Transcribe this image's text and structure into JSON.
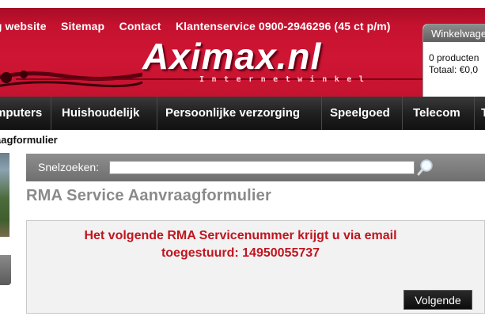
{
  "header": {
    "links": [
      "eg website",
      "Sitemap",
      "Contact",
      "Klantenservice 0900-2946296 (45 ct p/m)"
    ],
    "logo_text": "Aximax.nl",
    "logo_sub": "Internetwinkel"
  },
  "cart": {
    "title": "Winkelwagen",
    "count_text": "0 producten",
    "total_text": "Totaal: €0,0"
  },
  "nav": {
    "items": [
      "mputers",
      "Huishoudelijk",
      "Persoonlijke verzorging",
      "Speelgoed",
      "Telecom",
      "T"
    ]
  },
  "breadcrumb": "aagformulier",
  "search": {
    "label": "Snelzoeken:",
    "value": "",
    "placeholder": ""
  },
  "page": {
    "title": "RMA Service Aanvraagformulier",
    "message_line1": "Het volgende RMA Servicenummer krijgt u via email",
    "message_line2": "toegestuurd: 14950055737",
    "next_button": "Volgende"
  },
  "colors": {
    "brand_red": "#cf1534",
    "message_red": "#c0151f",
    "nav_bg": "#1e1e1e",
    "search_bar_bg": "#7d7d7d"
  }
}
